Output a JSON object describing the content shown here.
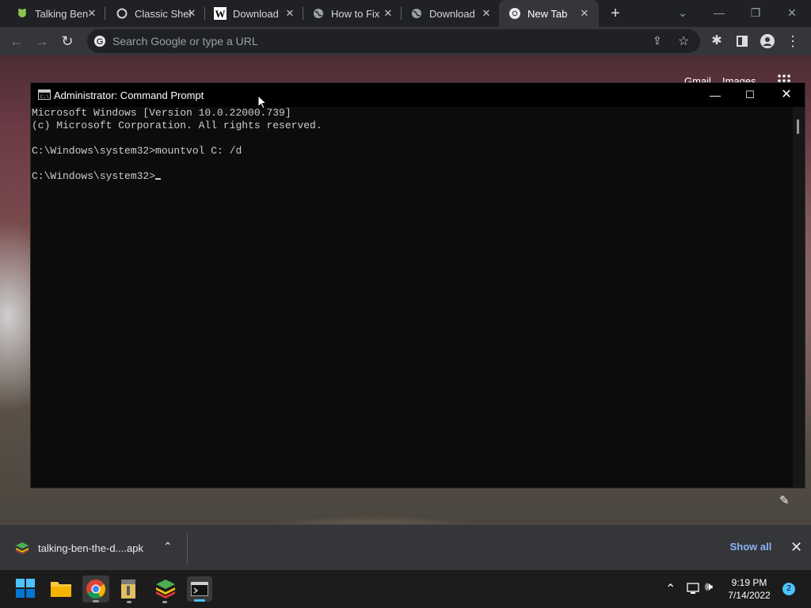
{
  "browser": {
    "tabs": [
      {
        "title": "Talking Ben",
        "icon": "talking-ben-favicon"
      },
      {
        "title": "Classic Shel",
        "icon": "circle-favicon"
      },
      {
        "title": "Download",
        "icon": "w-favicon"
      },
      {
        "title": "How to Fix",
        "icon": "globe-favicon"
      },
      {
        "title": "Download",
        "icon": "globe-favicon"
      },
      {
        "title": "New Tab",
        "icon": "chrome-favicon"
      }
    ],
    "omnibox_placeholder": "Search Google or type a URL"
  },
  "newtab": {
    "gmail": "Gmail",
    "images": "Images"
  },
  "cmd": {
    "title": "Administrator: Command Prompt",
    "lines": [
      "Microsoft Windows [Version 10.0.22000.739]",
      "(c) Microsoft Corporation. All rights reserved.",
      "",
      "C:\\Windows\\system32>mountvol C: /d",
      "",
      "C:\\Windows\\system32>"
    ]
  },
  "downloads": {
    "filename": "talking-ben-the-d....apk",
    "show_all": "Show all"
  },
  "taskbar": {
    "time": "9:19 PM",
    "date": "7/14/2022",
    "notifications": "2"
  },
  "colors": {
    "accent_blue": "#8ab4f8",
    "windows_blue": "#0078d4"
  }
}
